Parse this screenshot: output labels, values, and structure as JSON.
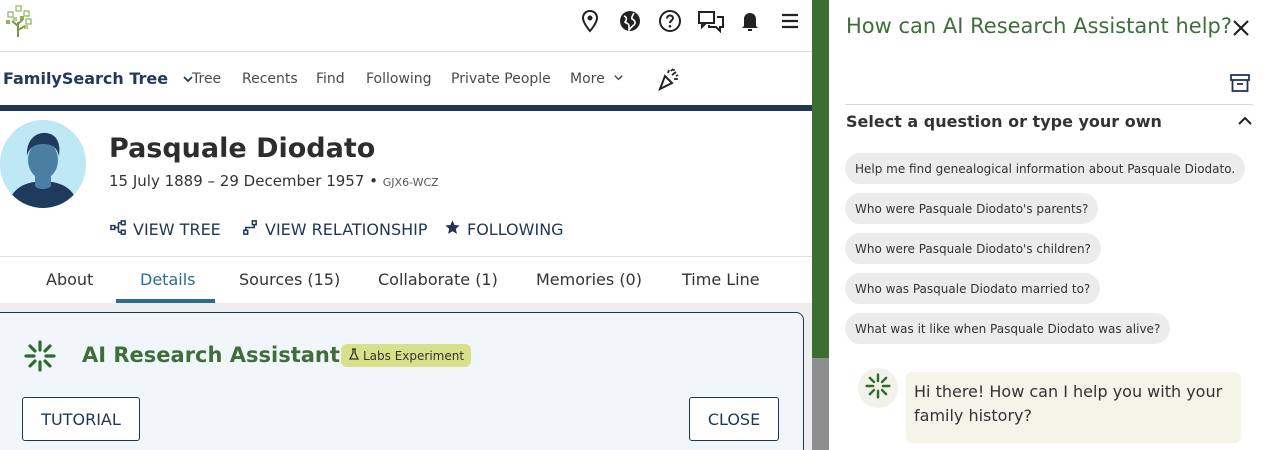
{
  "topbar": {
    "icons": [
      "location-pin-icon",
      "globe-icon",
      "help-icon",
      "messages-icon",
      "bell-icon",
      "menu-icon"
    ]
  },
  "nav": {
    "brand": "FamilySearch Tree",
    "items": [
      {
        "label": "Tree"
      },
      {
        "label": "Recents"
      },
      {
        "label": "Find"
      },
      {
        "label": "Following"
      },
      {
        "label": "Private People"
      },
      {
        "label": "More"
      }
    ]
  },
  "person": {
    "name": "Pasquale Diodato",
    "dates": "15 July 1889 – 29 December 1957",
    "separator": " • ",
    "id": "GJX6-WCZ"
  },
  "actions": {
    "view_tree": "VIEW TREE",
    "view_relationship": "VIEW RELATIONSHIP",
    "following": "FOLLOWING"
  },
  "tabs": [
    {
      "label": "About"
    },
    {
      "label": "Details"
    },
    {
      "label": "Sources (15)"
    },
    {
      "label": "Collaborate (1)"
    },
    {
      "label": "Memories (0)"
    },
    {
      "label": "Time Line"
    }
  ],
  "active_tab": "Details",
  "ai_card": {
    "title": "AI Research Assistant",
    "badge": "Labs Experiment",
    "tutorial_button": "TUTORIAL",
    "close_button": "CLOSE"
  },
  "assistant_panel": {
    "title": "How can AI Research Assistant help?",
    "section_title": "Select a question or type your own",
    "suggestions": [
      "Help me find genealogical information about Pasquale Diodato.",
      "Who were Pasquale Diodato's parents?",
      "Who were Pasquale Diodato's children?",
      "Who was Pasquale Diodato married to?",
      "What was it like when Pasquale Diodato was alive?"
    ],
    "bot_message": "Hi there! How can I help you with your family history?"
  },
  "colors": {
    "navy": "#1f3658",
    "green": "#3f6e3b",
    "strip_green": "#3c6e31",
    "badge": "#d9e08a",
    "tab_accent": "#2d6b91"
  }
}
